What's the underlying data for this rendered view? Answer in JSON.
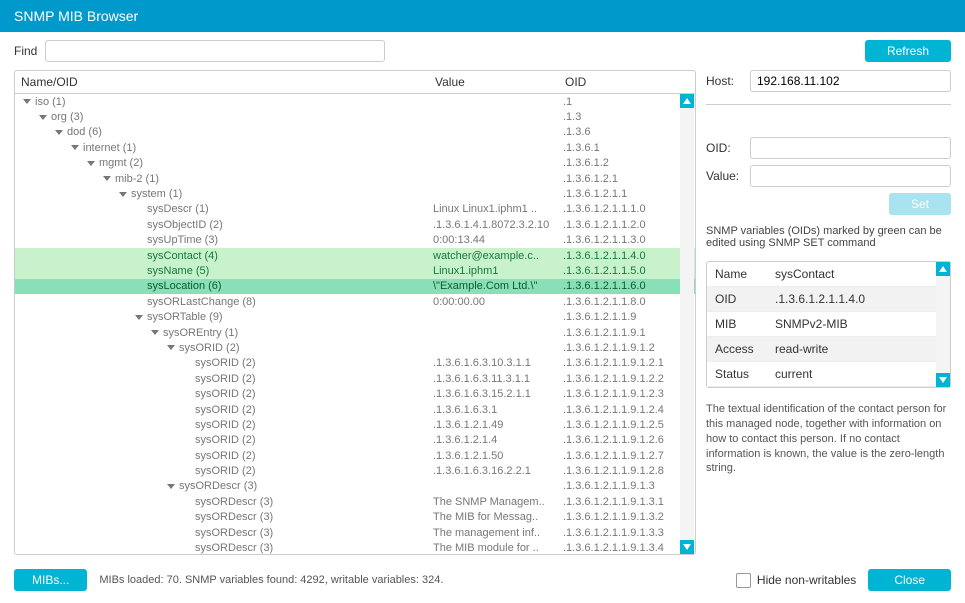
{
  "title": "SNMP MIB Browser",
  "toolbar": {
    "find_label": "Find",
    "find_value": "",
    "refresh_label": "Refresh"
  },
  "columns": {
    "name": "Name/OID",
    "value": "Value",
    "oid": "OID"
  },
  "tree": [
    {
      "indent": 0,
      "exp": true,
      "name": "iso (1)",
      "value": "",
      "oid": ".1"
    },
    {
      "indent": 1,
      "exp": true,
      "name": "org (3)",
      "value": "",
      "oid": ".1.3"
    },
    {
      "indent": 2,
      "exp": true,
      "name": "dod (6)",
      "value": "",
      "oid": ".1.3.6"
    },
    {
      "indent": 3,
      "exp": true,
      "name": "internet (1)",
      "value": "",
      "oid": ".1.3.6.1"
    },
    {
      "indent": 4,
      "exp": true,
      "name": "mgmt (2)",
      "value": "",
      "oid": ".1.3.6.1.2"
    },
    {
      "indent": 5,
      "exp": true,
      "name": "mib-2 (1)",
      "value": "",
      "oid": ".1.3.6.1.2.1"
    },
    {
      "indent": 6,
      "exp": true,
      "name": "system (1)",
      "value": "",
      "oid": ".1.3.6.1.2.1.1"
    },
    {
      "indent": 7,
      "exp": false,
      "name": "sysDescr (1)",
      "value": "Linux Linux1.iphm1 ..",
      "oid": ".1.3.6.1.2.1.1.1.0"
    },
    {
      "indent": 7,
      "exp": false,
      "name": "sysObjectID (2)",
      "value": ".1.3.6.1.4.1.8072.3.2.10",
      "oid": ".1.3.6.1.2.1.1.2.0"
    },
    {
      "indent": 7,
      "exp": false,
      "name": "sysUpTime (3)",
      "value": "0:00:13.44",
      "oid": ".1.3.6.1.2.1.1.3.0"
    },
    {
      "indent": 7,
      "exp": false,
      "name": "sysContact (4)",
      "value": "watcher@example.c..",
      "oid": ".1.3.6.1.2.1.1.4.0",
      "green": true
    },
    {
      "indent": 7,
      "exp": false,
      "name": "sysName (5)",
      "value": "Linux1.iphm1",
      "oid": ".1.3.6.1.2.1.1.5.0",
      "green": true
    },
    {
      "indent": 7,
      "exp": false,
      "name": "sysLocation (6)",
      "value": "\\\"Example.Com Ltd.\\\"",
      "oid": ".1.3.6.1.2.1.1.6.0",
      "green": true,
      "selected": true
    },
    {
      "indent": 7,
      "exp": false,
      "name": "sysORLastChange (8)",
      "value": "0:00:00.00",
      "oid": ".1.3.6.1.2.1.1.8.0"
    },
    {
      "indent": 7,
      "exp": true,
      "name": "sysORTable (9)",
      "value": "",
      "oid": ".1.3.6.1.2.1.1.9"
    },
    {
      "indent": 8,
      "exp": true,
      "name": "sysOREntry (1)",
      "value": "",
      "oid": ".1.3.6.1.2.1.1.9.1"
    },
    {
      "indent": 9,
      "exp": true,
      "name": "sysORID (2)",
      "value": "",
      "oid": ".1.3.6.1.2.1.1.9.1.2"
    },
    {
      "indent": 10,
      "exp": false,
      "name": "sysORID (2)",
      "value": ".1.3.6.1.6.3.10.3.1.1",
      "oid": ".1.3.6.1.2.1.1.9.1.2.1"
    },
    {
      "indent": 10,
      "exp": false,
      "name": "sysORID (2)",
      "value": ".1.3.6.1.6.3.11.3.1.1",
      "oid": ".1.3.6.1.2.1.1.9.1.2.2"
    },
    {
      "indent": 10,
      "exp": false,
      "name": "sysORID (2)",
      "value": ".1.3.6.1.6.3.15.2.1.1",
      "oid": ".1.3.6.1.2.1.1.9.1.2.3"
    },
    {
      "indent": 10,
      "exp": false,
      "name": "sysORID (2)",
      "value": ".1.3.6.1.6.3.1",
      "oid": ".1.3.6.1.2.1.1.9.1.2.4"
    },
    {
      "indent": 10,
      "exp": false,
      "name": "sysORID (2)",
      "value": ".1.3.6.1.2.1.49",
      "oid": ".1.3.6.1.2.1.1.9.1.2.5"
    },
    {
      "indent": 10,
      "exp": false,
      "name": "sysORID (2)",
      "value": ".1.3.6.1.2.1.4",
      "oid": ".1.3.6.1.2.1.1.9.1.2.6"
    },
    {
      "indent": 10,
      "exp": false,
      "name": "sysORID (2)",
      "value": ".1.3.6.1.2.1.50",
      "oid": ".1.3.6.1.2.1.1.9.1.2.7"
    },
    {
      "indent": 10,
      "exp": false,
      "name": "sysORID (2)",
      "value": ".1.3.6.1.6.3.16.2.2.1",
      "oid": ".1.3.6.1.2.1.1.9.1.2.8"
    },
    {
      "indent": 9,
      "exp": true,
      "name": "sysORDescr (3)",
      "value": "",
      "oid": ".1.3.6.1.2.1.1.9.1.3"
    },
    {
      "indent": 10,
      "exp": false,
      "name": "sysORDescr (3)",
      "value": "The SNMP Managem..",
      "oid": ".1.3.6.1.2.1.1.9.1.3.1"
    },
    {
      "indent": 10,
      "exp": false,
      "name": "sysORDescr (3)",
      "value": "The MIB for Messag..",
      "oid": ".1.3.6.1.2.1.1.9.1.3.2"
    },
    {
      "indent": 10,
      "exp": false,
      "name": "sysORDescr (3)",
      "value": "The management inf..",
      "oid": ".1.3.6.1.2.1.1.9.1.3.3"
    },
    {
      "indent": 10,
      "exp": false,
      "name": "sysORDescr (3)",
      "value": "The MIB module for ..",
      "oid": ".1.3.6.1.2.1.1.9.1.3.4"
    }
  ],
  "host": {
    "label": "Host:",
    "value": "192.168.11.102"
  },
  "oid_field": {
    "label": "OID:",
    "value": ""
  },
  "value_field": {
    "label": "Value:",
    "value": ""
  },
  "set_label": "Set",
  "info_text": "SNMP variables (OIDs) marked by green can be edited using SNMP SET command",
  "detail": {
    "name_k": "Name",
    "name_v": "sysContact",
    "oid_k": "OID",
    "oid_v": ".1.3.6.1.2.1.1.4.0",
    "mib_k": "MIB",
    "mib_v": "SNMPv2-MIB",
    "access_k": "Access",
    "access_v": "read-write",
    "status_k": "Status",
    "status_v": "current"
  },
  "desc": "The textual identification of the contact person for this managed node, together with information on how to contact this person. If no contact information is known, the value is the zero-length string.",
  "footer": {
    "mibs_label": "MIBs...",
    "status": "MIBs loaded: 70. SNMP variables found: 4292, writable variables: 324.",
    "hide_label": "Hide non-writables",
    "close_label": "Close"
  }
}
